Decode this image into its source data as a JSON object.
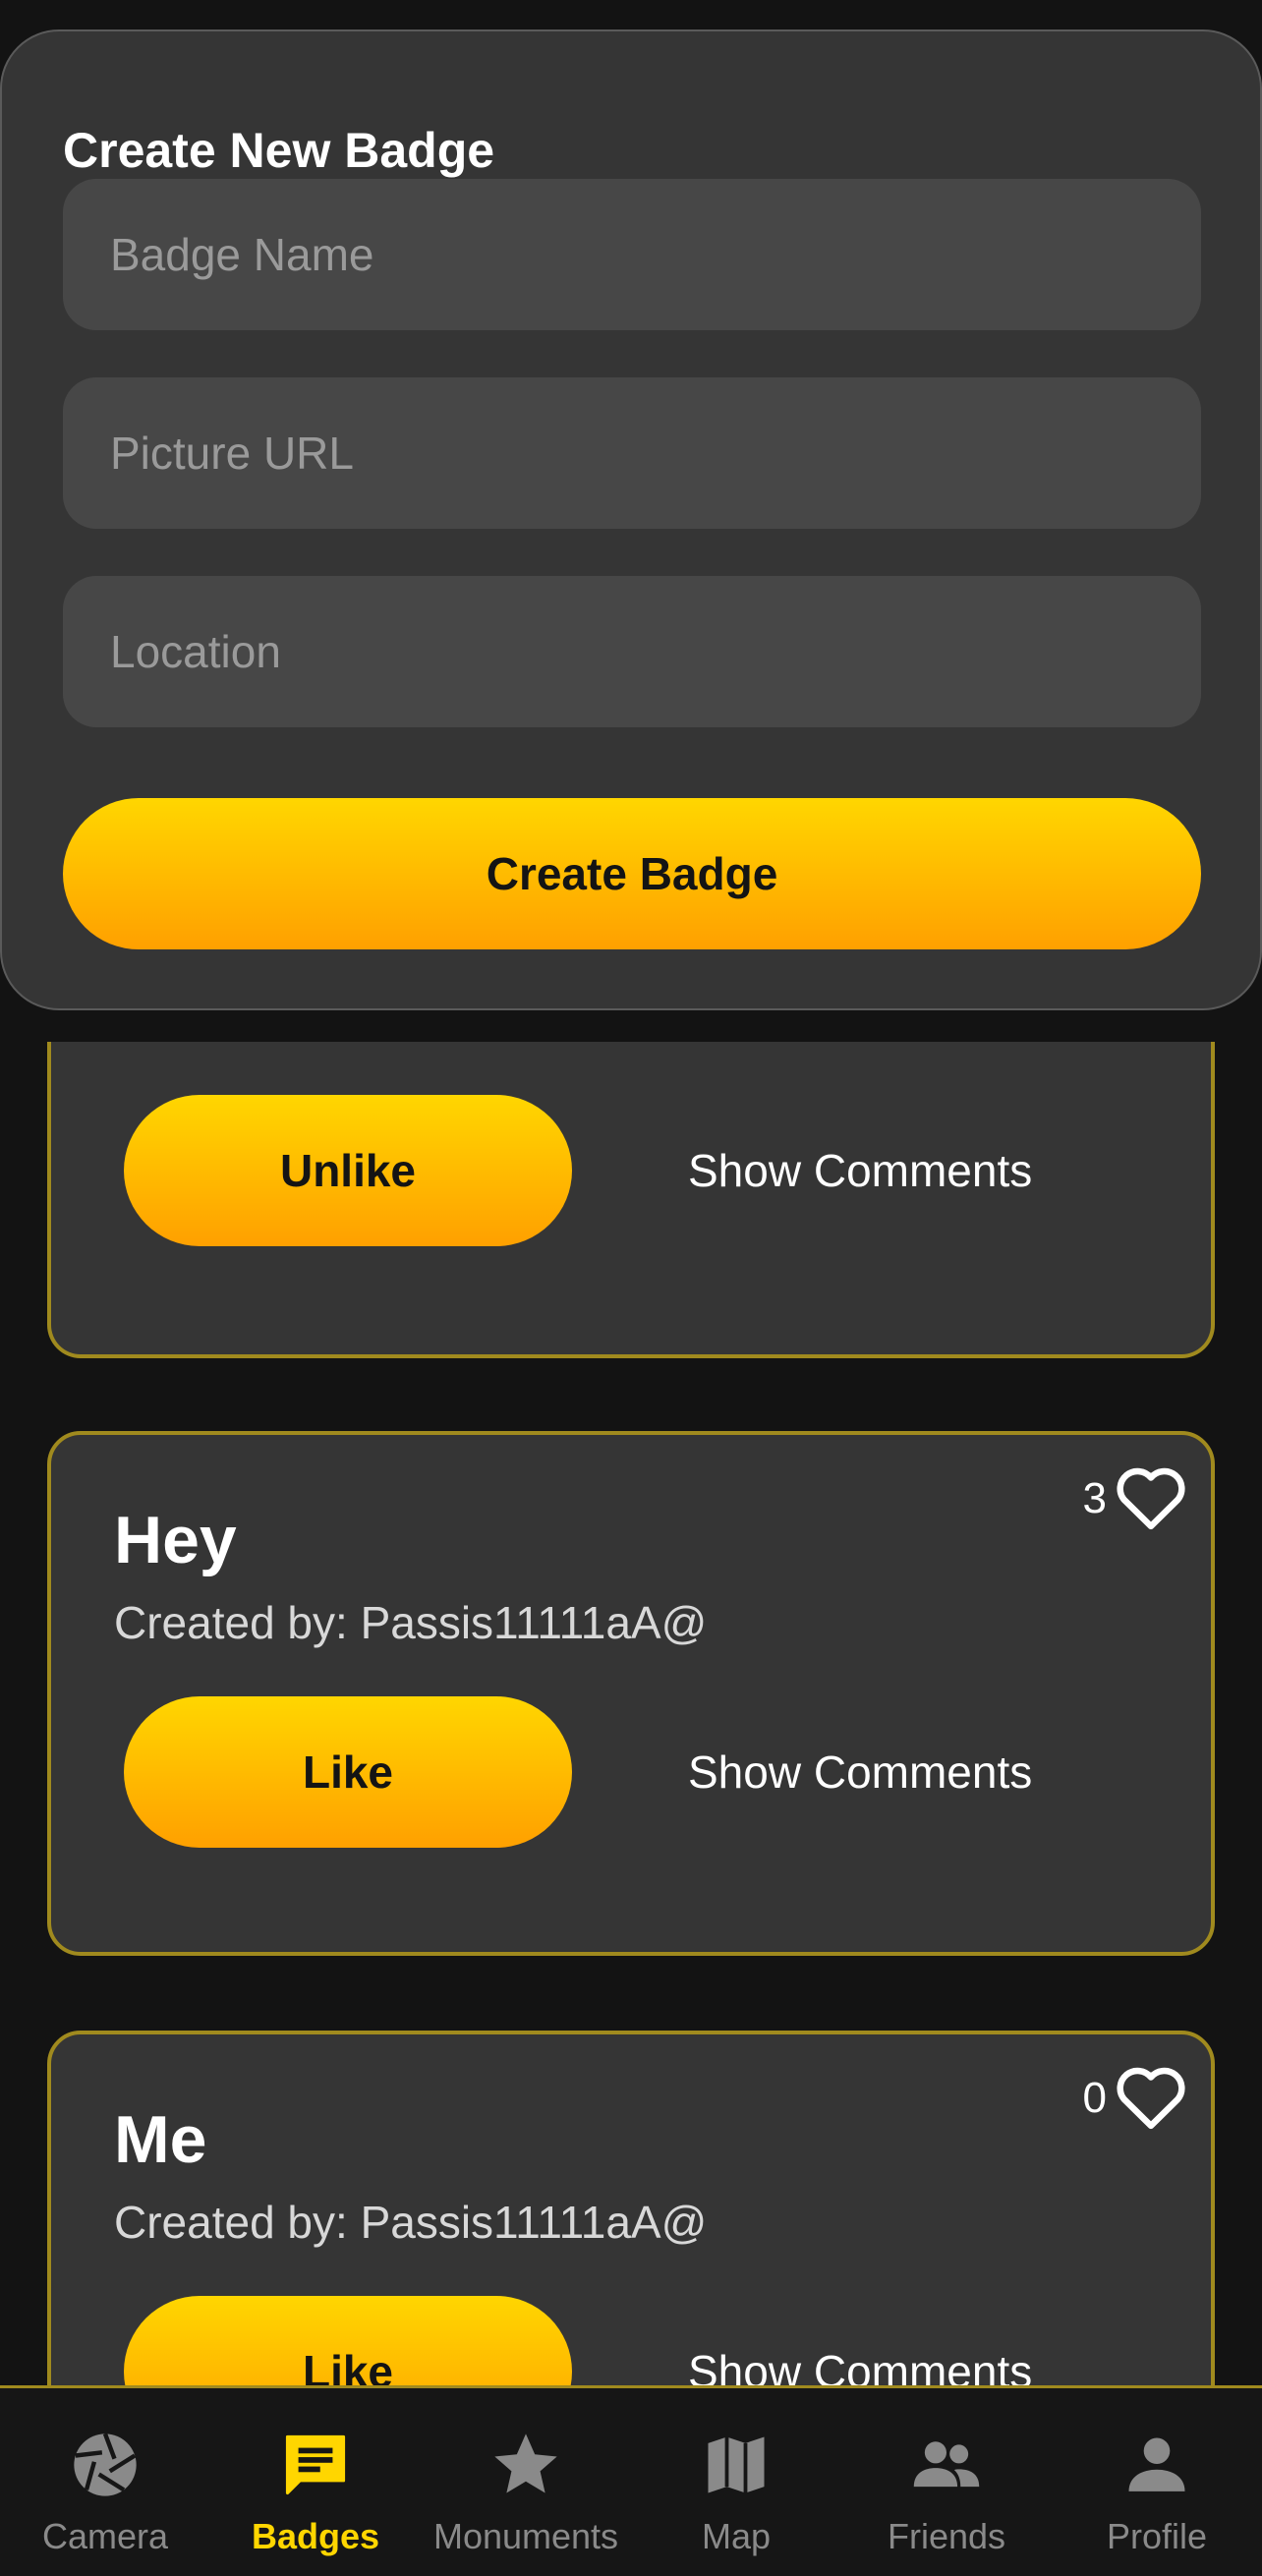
{
  "create_panel": {
    "title": "Create New Badge",
    "badge_name_placeholder": "Badge Name",
    "picture_url_placeholder": "Picture URL",
    "location_placeholder": "Location",
    "submit_label": "Create Badge"
  },
  "feed": {
    "partial_card": {
      "like_button_label": "Unlike",
      "comments_label": "Show Comments"
    },
    "cards": [
      {
        "title": "Hey",
        "creator": "Created by: Passis11111aA@",
        "likes": "3",
        "like_button_label": "Like",
        "comments_label": "Show Comments"
      },
      {
        "title": "Me",
        "creator": "Created by: Passis11111aA@",
        "likes": "0",
        "like_button_label": "Like",
        "comments_label": "Show Comments"
      }
    ]
  },
  "tabbar": {
    "active": "Badges",
    "accent_color": "#ffd600",
    "items": [
      {
        "label": "Camera",
        "icon": "camera-aperture-icon"
      },
      {
        "label": "Badges",
        "icon": "chat-bubble-icon"
      },
      {
        "label": "Monuments",
        "icon": "star-icon"
      },
      {
        "label": "Map",
        "icon": "map-icon"
      },
      {
        "label": "Friends",
        "icon": "people-icon"
      },
      {
        "label": "Profile",
        "icon": "person-icon"
      }
    ]
  }
}
